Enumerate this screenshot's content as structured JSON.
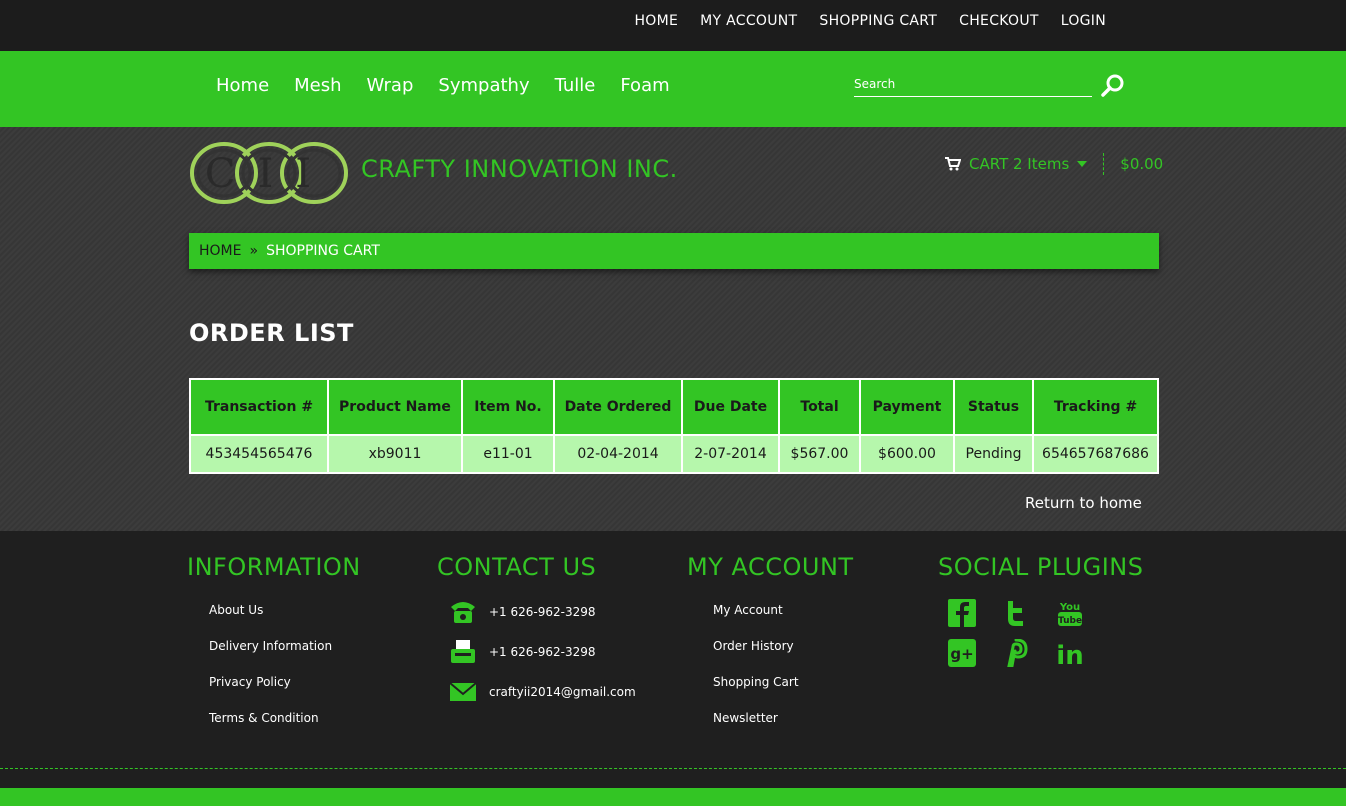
{
  "top_nav": {
    "items": [
      {
        "label": "HOME"
      },
      {
        "label": "MY ACCOUNT"
      },
      {
        "label": "SHOPPING CART"
      },
      {
        "label": "CHECKOUT"
      },
      {
        "label": "LOGIN"
      }
    ]
  },
  "main_nav": {
    "items": [
      {
        "label": "Home"
      },
      {
        "label": "Mesh"
      },
      {
        "label": "Wrap"
      },
      {
        "label": "Sympathy"
      },
      {
        "label": "Tulle"
      },
      {
        "label": "Foam"
      }
    ]
  },
  "search": {
    "placeholder": "Search",
    "icon": "search-icon"
  },
  "brand": {
    "logo_text": "CII",
    "name": "CRAFTY INNOVATION INC."
  },
  "cart": {
    "label": "CART 2 Items",
    "total": "$0.00",
    "icon": "cart-icon"
  },
  "breadcrumb": {
    "home": "HOME",
    "separator": "»",
    "current": "SHOPPING CART"
  },
  "page_title": "ORDER LIST",
  "table": {
    "headers": [
      "Transaction #",
      "Product Name",
      "Item No.",
      "Date Ordered",
      "Due Date",
      "Total",
      "Payment",
      "Status",
      "Tracking #"
    ],
    "rows": [
      [
        "453454565476",
        "xb9011",
        "e11-01",
        "02-04-2014",
        "2-07-2014",
        "$567.00",
        "$600.00",
        "Pending",
        "654657687686"
      ]
    ]
  },
  "return_link": "Return to home",
  "footer": {
    "information": {
      "title": "INFORMATION",
      "links": [
        "About Us",
        "Delivery Information",
        "Privacy Policy",
        "Terms & Condition"
      ]
    },
    "contact": {
      "title": "CONTACT US",
      "phone": "+1 626-962-3298",
      "fax": "+1 626-962-3298",
      "email": "craftyii2014@gmail.com"
    },
    "account": {
      "title": "MY ACCOUNT",
      "links": [
        "My Account",
        "Order History",
        "Shopping Cart",
        "Newsletter"
      ]
    },
    "social": {
      "title": "SOCIAL PLUGINS",
      "icons": [
        "facebook-icon",
        "twitter-icon",
        "youtube-icon",
        "google-plus-icon",
        "pinterest-icon",
        "linkedin-icon"
      ],
      "youtube_lines": [
        "You",
        "Tube"
      ],
      "gplus_text": "g+",
      "linkedin_text": "in"
    }
  },
  "colors": {
    "accent": "#33c524",
    "dark": "#1c1c1c",
    "table_row": "#b6f7ac"
  }
}
